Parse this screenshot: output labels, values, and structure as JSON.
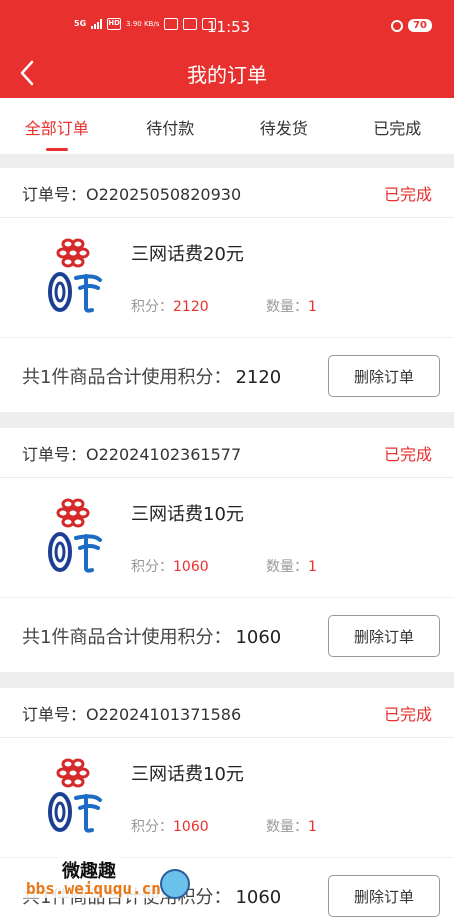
{
  "status_bar": {
    "signal": "5G",
    "hd": "HD",
    "speed": "3.90 KB/s",
    "time": "11:53",
    "battery": "70"
  },
  "nav": {
    "title": "我的订单"
  },
  "tabs": [
    {
      "label": "全部订单",
      "active": true
    },
    {
      "label": "待付款",
      "active": false
    },
    {
      "label": "待发货",
      "active": false
    },
    {
      "label": "已完成",
      "active": false
    }
  ],
  "labels": {
    "order_no": "订单号：",
    "points": "积分：",
    "quantity": "数量：",
    "summary": "共1件商品合计使用积分：",
    "delete": "删除订单"
  },
  "orders": [
    {
      "no": "O22025050820930",
      "status": "已完成",
      "name": "三网话费20元",
      "points": "2120",
      "qty": "1",
      "total": "2120"
    },
    {
      "no": "O22024102361577",
      "status": "已完成",
      "name": "三网话费10元",
      "points": "1060",
      "qty": "1",
      "total": "1060"
    },
    {
      "no": "O22024101371586",
      "status": "已完成",
      "name": "三网话费10元",
      "points": "1060",
      "qty": "1",
      "total": "1060"
    }
  ],
  "watermark": {
    "title": "微趣趣",
    "url": "bbs.weiququ.cn"
  },
  "colors": {
    "accent": "#e8302e",
    "background": "#eeeeee"
  }
}
